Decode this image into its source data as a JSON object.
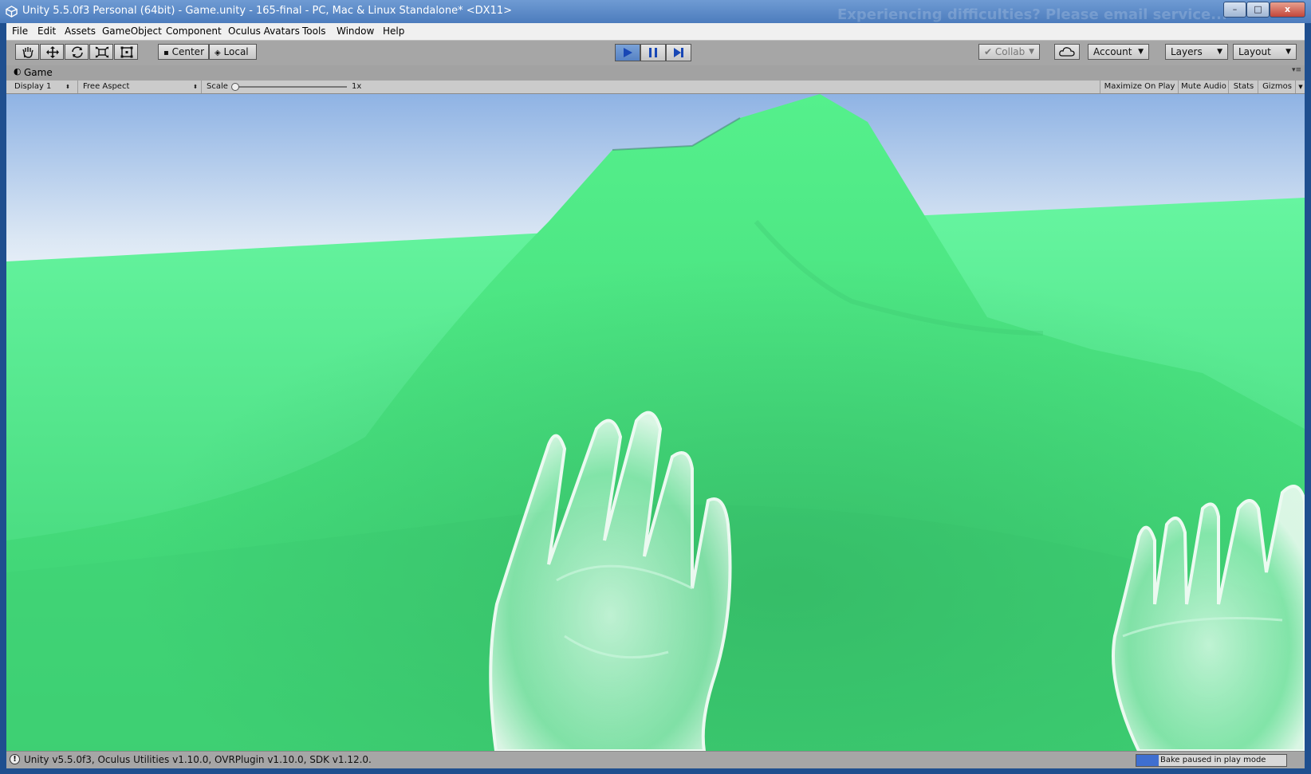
{
  "window": {
    "title": "Unity 5.5.0f3 Personal (64bit) - Game.unity - 165-final - PC, Mac & Linux Standalone* <DX11>",
    "watermark": "Experiencing difficulties? Please email service...",
    "minimize": "–",
    "maximize": "□",
    "close": "x"
  },
  "menu": [
    "File",
    "Edit",
    "Assets",
    "GameObject",
    "Component",
    "Oculus Avatars",
    "Tools",
    "Window",
    "Help"
  ],
  "toolbar": {
    "tools": [
      "hand-icon",
      "move-icon",
      "rotate-icon",
      "scale-icon",
      "rect-tool-icon"
    ],
    "pivot_label": "Center",
    "space_label": "Local",
    "play_state": "playing",
    "collab_label": "Collab",
    "account_label": "Account",
    "layers_label": "Layers",
    "layout_label": "Layout"
  },
  "game_tab": {
    "label": "Game",
    "display": "Display 1",
    "aspect": "Free Aspect",
    "scale_label": "Scale",
    "scale_value": "1x",
    "maximize_on_play": "Maximize On Play",
    "mute_audio": "Mute Audio",
    "stats": "Stats",
    "gizmos": "Gizmos"
  },
  "status": {
    "message": "Unity v5.5.0f3, Oculus Utilities v1.10.0, OVRPlugin v1.10.0, SDK v1.12.0.",
    "bake_text": "Bake paused in play mode",
    "bake_progress": 0.15
  },
  "colors": {
    "accent": "#3f6fd0",
    "terrain": "#3fd97a",
    "sky": "#a8c4ea"
  }
}
